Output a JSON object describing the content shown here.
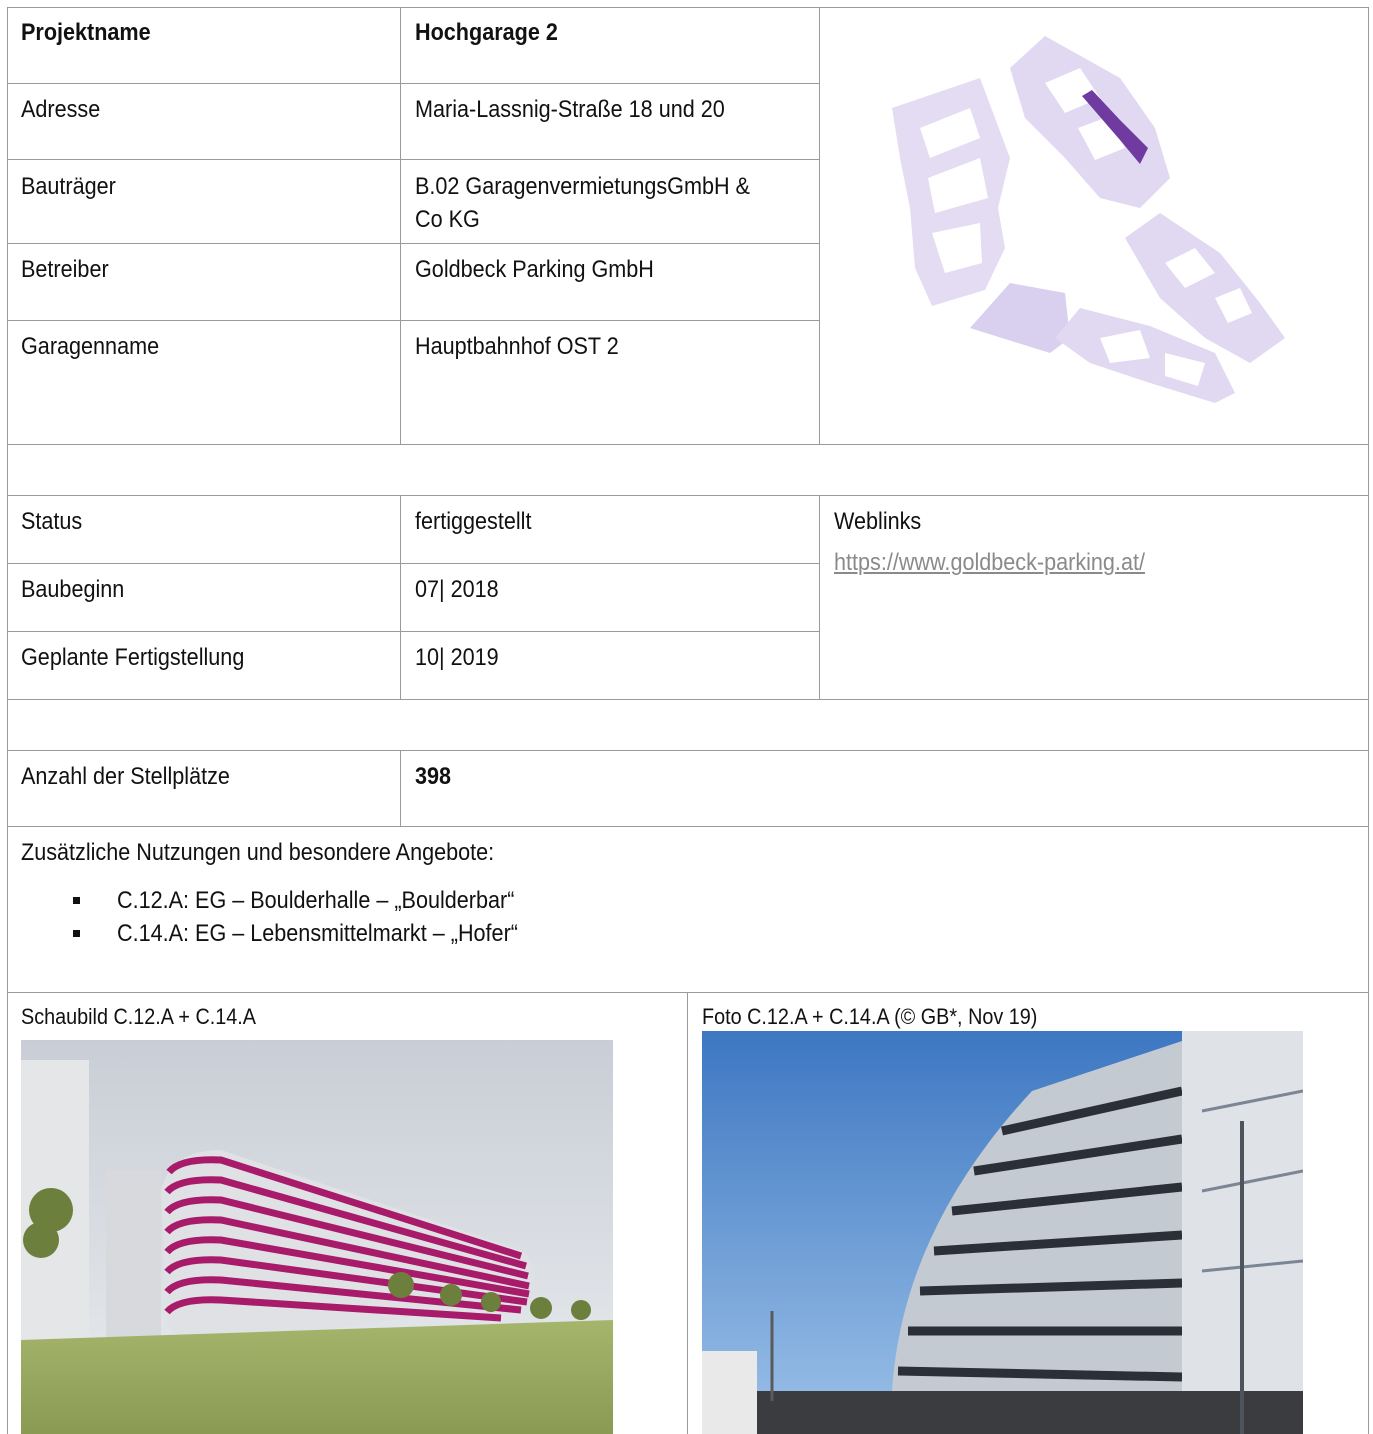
{
  "project": {
    "label_name": "Projektname",
    "value_name": "Hochgarage 2",
    "label_address": "Adresse",
    "value_address": "Maria-Lassnig-Straße 18 und 20",
    "label_developer": "Bauträger",
    "value_developer_line1": "B.02 GaragenvermietungsGmbH &",
    "value_developer_line2": "Co KG",
    "label_operator": "Betreiber",
    "value_operator": "Goldbeck Parking GmbH",
    "label_garage": "Garagenname",
    "value_garage": "Hauptbahnhof OST 2"
  },
  "status": {
    "label_status": "Status",
    "value_status": "fertiggestellt",
    "label_start": "Baubeginn",
    "value_start": "07| 2018",
    "label_finish": "Geplante Fertigstellung",
    "value_finish": "10| 2019"
  },
  "weblinks": {
    "label": "Weblinks",
    "url": "https://www.goldbeck-parking.at/"
  },
  "parking": {
    "label": "Anzahl der Stellplätze",
    "value": "398"
  },
  "extras": {
    "heading": "Zusätzliche Nutzungen und besondere Angebote:",
    "items": [
      "C.12.A: EG – Boulderhalle – „Boulderbar“",
      "C.14.A: EG – Lebensmittelmarkt – „Hofer“"
    ]
  },
  "images": {
    "render_caption": "Schaubild C.12.A + C.14.A",
    "photo_caption": "Foto C.12.A + C.14.A (© GB*, Nov 19)"
  },
  "colors": {
    "map_light": "#dcd3ef",
    "map_highlight": "#6f3ba1",
    "grid": "#9a9a9a",
    "link": "#8a8a8a"
  }
}
